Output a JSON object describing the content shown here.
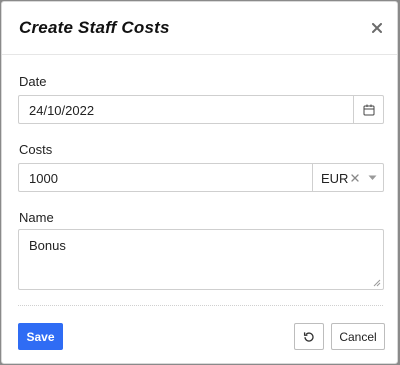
{
  "modal": {
    "title": "Create Staff Costs",
    "close_icon": "close-icon"
  },
  "form": {
    "date": {
      "label": "Date",
      "value": "24/10/2022",
      "icon": "calendar-icon"
    },
    "costs": {
      "label": "Costs",
      "value": "1000",
      "currency": "EUR",
      "clear_icon": "clear-icon",
      "caret_icon": "chevron-down-icon"
    },
    "name": {
      "label": "Name",
      "value": "Bonus"
    }
  },
  "footer": {
    "save_label": "Save",
    "reset_icon": "reset-icon",
    "cancel_label": "Cancel"
  },
  "colors": {
    "primary": "#2f6cf4",
    "border": "#cfcfcf",
    "backdrop": "#8a8a8a"
  }
}
